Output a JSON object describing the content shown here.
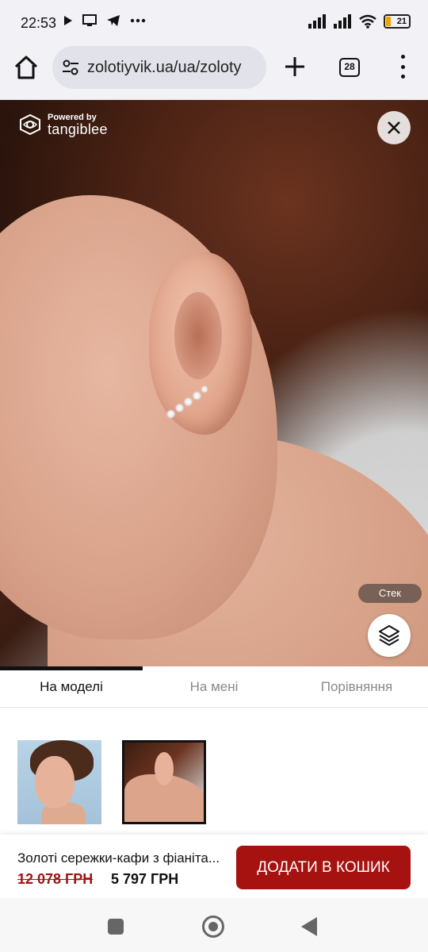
{
  "status_bar": {
    "time": "22:53",
    "battery_level": "21",
    "icons": [
      "play-icon",
      "screen-icon",
      "telegram-icon",
      "more-dots-icon",
      "signal-icon",
      "signal-icon",
      "wifi-icon",
      "battery-icon"
    ]
  },
  "browser": {
    "url": "zolotiyvik.ua/ua/zoloty",
    "tab_count": "28"
  },
  "viewer": {
    "powered_small": "Powered by",
    "powered_brand": "tangiblee",
    "stack_label": "Стек"
  },
  "tabs": [
    {
      "label": "На моделі",
      "active": true
    },
    {
      "label": "На мені",
      "active": false
    },
    {
      "label": "Порівняння",
      "active": false
    }
  ],
  "product": {
    "name": "Золоті сережки-кафи з фіаніта...",
    "price_old": "12 078 ГРН",
    "price_new": "5 797 ГРН",
    "add_to_cart": "ДОДАТИ В КОШИК"
  },
  "colors": {
    "accent": "#a5120f",
    "old_price": "#a31212"
  }
}
